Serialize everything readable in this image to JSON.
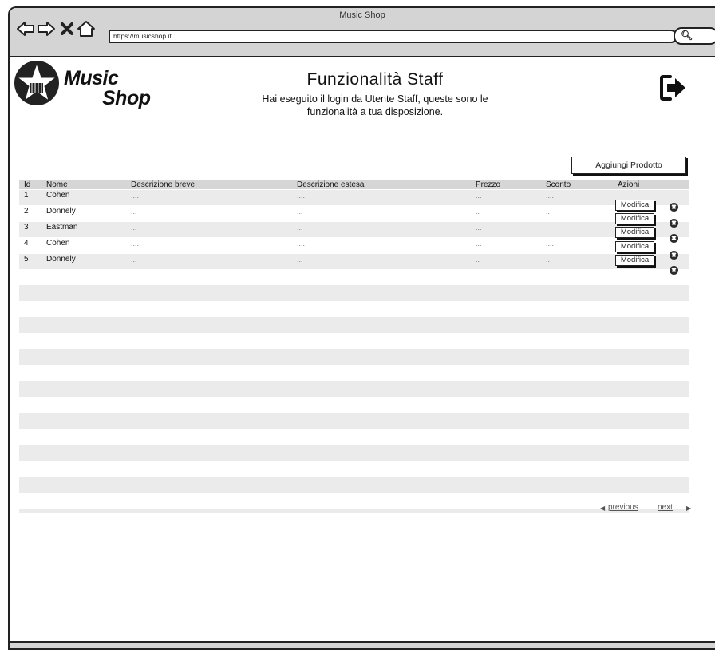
{
  "browser": {
    "window_title": "Music Shop",
    "url": "https://musicshop.it"
  },
  "header": {
    "logo_line1": "Music",
    "logo_line2": "Shop",
    "title": "Funzionalità Staff",
    "subtitle": "Hai eseguito il login da Utente Staff, queste sono le funzionalità a tua disposizione."
  },
  "actions": {
    "add_product_label": "Aggiungi Prodotto"
  },
  "table": {
    "columns": [
      "Id",
      "Nome",
      "Descrizione breve",
      "Descrizione estesa",
      "Prezzo",
      "Sconto",
      "Azioni"
    ],
    "rows": [
      {
        "id": "1",
        "nome": "Cohen",
        "breve": "....",
        "estesa": "....",
        "prezzo": "...",
        "sconto": "....",
        "azione": "Modifica"
      },
      {
        "id": "2",
        "nome": "Donnely",
        "breve": "...",
        "estesa": "...",
        "prezzo": "..",
        "sconto": "..",
        "azione": "Modifica"
      },
      {
        "id": "3",
        "nome": "Eastman",
        "breve": "...",
        "estesa": "...",
        "prezzo": "...",
        "sconto": "",
        "azione": "Modifica"
      },
      {
        "id": "4",
        "nome": "Cohen",
        "breve": "....",
        "estesa": "....",
        "prezzo": "...",
        "sconto": "....",
        "azione": "Modifica"
      },
      {
        "id": "5",
        "nome": "Donnely",
        "breve": "...",
        "estesa": "...",
        "prezzo": "..",
        "sconto": "..",
        "azione": "Modifica"
      }
    ]
  },
  "pagination": {
    "previous_label": "previous",
    "next_label": "next"
  }
}
